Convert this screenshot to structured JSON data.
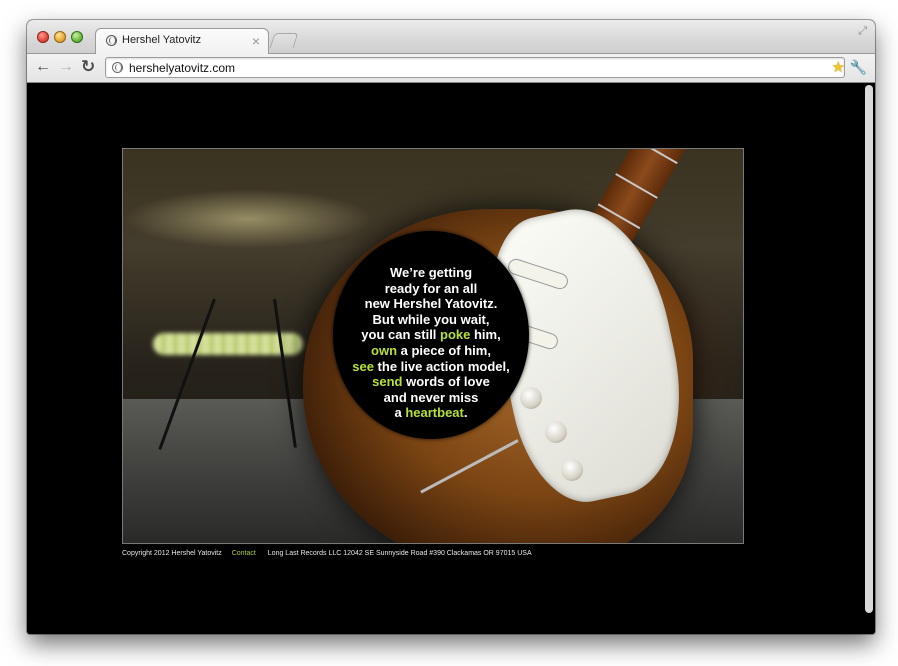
{
  "browser": {
    "tab_title": "Hershel Yatovitz",
    "tab_close_glyph": "×",
    "url": "hershelyatovitz.com",
    "icons": [
      "globe-favicon-icon",
      "back-arrow-icon",
      "forward-arrow-icon",
      "reload-icon",
      "star-icon",
      "wrench-icon",
      "fullscreen-icon"
    ]
  },
  "hero": {
    "message_lines": [
      {
        "pre": "We’re getting",
        "hl": "",
        "post": ""
      },
      {
        "pre": "ready for an all",
        "hl": "",
        "post": ""
      },
      {
        "pre": "new Hershel Yatovitz.",
        "hl": "",
        "post": ""
      },
      {
        "pre": "But while you wait,",
        "hl": "",
        "post": ""
      },
      {
        "pre": "you can still ",
        "hl": "poke",
        "post": " him,"
      },
      {
        "pre": "",
        "hl": "own",
        "post": " a piece of him,"
      },
      {
        "pre": "",
        "hl": "see",
        "post": " the live action model,"
      },
      {
        "pre": "",
        "hl": "send",
        "post": " words of love"
      },
      {
        "pre": "and never miss",
        "hl": "",
        "post": ""
      },
      {
        "pre": "a ",
        "hl": "heartbeat",
        "post": "."
      }
    ],
    "highlight_color": "#b7e039"
  },
  "footer": {
    "copyright": "Copyright 2012 Hershel Yatovitz",
    "contact": "Contact",
    "address": "Long Last Records LLC 12042 SE Sunnyside Road #390 Clackamas OR 97015 USA"
  }
}
